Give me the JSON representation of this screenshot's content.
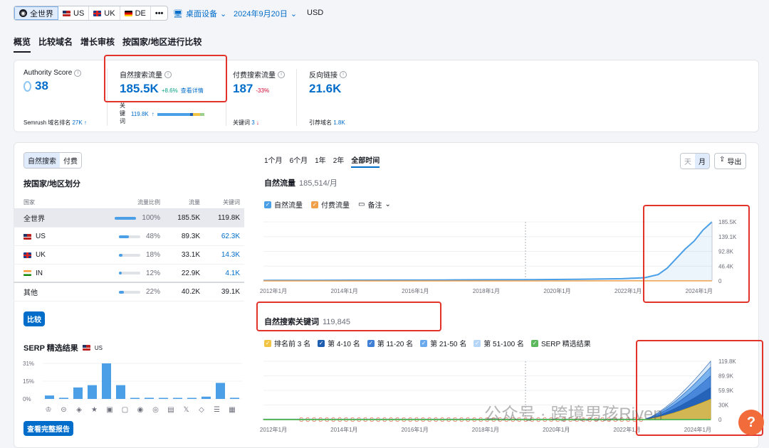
{
  "topbar": {
    "databases": [
      {
        "label": "全世界",
        "icon": "globe-icon"
      },
      {
        "label": "US",
        "icon": "us-flag-icon"
      },
      {
        "label": "UK",
        "icon": "uk-flag-icon"
      },
      {
        "label": "DE",
        "icon": "de-flag-icon"
      }
    ],
    "more": "•••",
    "device": "桌面设备",
    "date": "2024年9月20日",
    "currency": "USD"
  },
  "tabs": [
    "概览",
    "比较域名",
    "增长审核",
    "按国家/地区进行比较"
  ],
  "metrics": {
    "authority": {
      "title": "Authority Score",
      "value": "38",
      "foot_label": "Semrush 域名排名",
      "foot_value": "27K"
    },
    "organic": {
      "title": "自然搜索流量",
      "value": "185.5K",
      "change": "+8.6%",
      "details": "查看详情",
      "kw_label": "关键词",
      "kw_value": "119.8K"
    },
    "paid": {
      "title": "付费搜索流量",
      "value": "187",
      "change": "-33%",
      "kw_label": "关键词",
      "kw_value": "3"
    },
    "backlinks": {
      "title": "反向链接",
      "value": "21.6K",
      "ref_label": "引荐域名",
      "ref_value": "1.8K"
    }
  },
  "left": {
    "toggle": [
      "自然搜索",
      "付费"
    ],
    "section_title": "按国家/地区划分",
    "headers": [
      "国家",
      "流量比例",
      "流量",
      "关键词"
    ],
    "rows": [
      {
        "country": "全世界",
        "flag": "globe-icon",
        "share": "100%",
        "share_val": 1.0,
        "traffic": "185.5K",
        "keywords": "119.8K"
      },
      {
        "country": "US",
        "flag": "us-flag-icon",
        "share": "48%",
        "share_val": 0.48,
        "traffic": "89.3K",
        "keywords": "62.3K"
      },
      {
        "country": "UK",
        "flag": "uk-flag-icon",
        "share": "18%",
        "share_val": 0.18,
        "traffic": "33.1K",
        "keywords": "14.3K"
      },
      {
        "country": "IN",
        "flag": "in-flag-icon",
        "share": "12%",
        "share_val": 0.12,
        "traffic": "22.9K",
        "keywords": "4.1K"
      },
      {
        "country": "其他",
        "flag": "",
        "share": "22%",
        "share_val": 0.22,
        "traffic": "40.2K",
        "keywords": "39.1K"
      }
    ],
    "compare_btn": "比较",
    "serp_title": "SERP 精选结果",
    "serp_country": "US",
    "serp_yticks": [
      "31%",
      "15%",
      "0%"
    ],
    "serp_values": [
      3,
      1,
      10,
      12,
      31,
      12,
      0,
      1,
      0,
      0,
      0,
      2,
      14,
      1
    ],
    "serp_icons": [
      "crown-icon",
      "link-icon",
      "diamond-icon",
      "star-icon",
      "image-icon",
      "chat-icon",
      "pin-icon",
      "cap-icon",
      "news-icon",
      "x-icon",
      "tag-icon",
      "list-icon",
      "gallery-icon"
    ],
    "full_report_btn": "查看完整报告"
  },
  "right": {
    "ranges": [
      "1个月",
      "6个月",
      "1年",
      "2年",
      "全部时间"
    ],
    "granularity": [
      "天",
      "月"
    ],
    "export_label": "导出",
    "traffic_title": "自然流量",
    "traffic_value": "185,514/月",
    "traffic_legend": [
      "自然流量",
      "付费流量"
    ],
    "notes_label": "备注",
    "keywords_title": "自然搜索关键词",
    "keywords_value": "119,845",
    "kw_legend": [
      "排名前 3 名",
      "第 4-10 名",
      "第 11-20 名",
      "第 21-50 名",
      "第 51-100 名",
      "SERP 精选结果"
    ],
    "watermark": "公众号 · 跨境男孩Riven",
    "help": "?"
  },
  "chart_data": [
    {
      "type": "line",
      "title": "自然流量",
      "x": [
        "2012年1月",
        "2014年1月",
        "2016年1月",
        "2018年1月",
        "2020年1月",
        "2022年1月",
        "2024年1月"
      ],
      "yticks": [
        "185.5K",
        "139.1K",
        "92.8K",
        "46.4K",
        "0"
      ],
      "ylim": [
        0,
        185500
      ],
      "series": [
        {
          "name": "自然流量",
          "color": "#4a9fe6",
          "points": [
            [
              0,
              1500
            ],
            [
              0.1,
              1800
            ],
            [
              0.2,
              2200
            ],
            [
              0.3,
              2500
            ],
            [
              0.4,
              2800
            ],
            [
              0.5,
              3500
            ],
            [
              0.6,
              4000
            ],
            [
              0.7,
              5000
            ],
            [
              0.8,
              7000
            ],
            [
              0.85,
              10000
            ],
            [
              0.88,
              20000
            ],
            [
              0.9,
              40000
            ],
            [
              0.92,
              70000
            ],
            [
              0.94,
              100000
            ],
            [
              0.96,
              125000
            ],
            [
              0.98,
              160000
            ],
            [
              1.0,
              185500
            ]
          ]
        },
        {
          "name": "付费流量",
          "color": "#f0a04b",
          "points": [
            [
              0,
              0
            ],
            [
              0.9,
              200
            ],
            [
              1.0,
              187
            ]
          ]
        }
      ]
    },
    {
      "type": "area",
      "title": "自然搜索关键词",
      "x": [
        "2012年1月",
        "2014年1月",
        "2016年1月",
        "2018年1月",
        "2020年1月",
        "2022年1月",
        "2024年1月"
      ],
      "yticks": [
        "119.8K",
        "89.9K",
        "59.9K",
        "30K",
        "0"
      ],
      "ylim": [
        0,
        119800
      ],
      "series": [
        {
          "name": "排名前 3 名",
          "color": "#f2c443"
        },
        {
          "name": "第 4-10 名",
          "color": "#1f5db0"
        },
        {
          "name": "第 11-20 名",
          "color": "#3f7fd6"
        },
        {
          "name": "第 21-50 名",
          "color": "#6aa9ec"
        },
        {
          "name": "第 51-100 名",
          "color": "#b5d6f7"
        },
        {
          "name": "SERP 精选结果",
          "color": "#5cb85c"
        }
      ]
    }
  ]
}
